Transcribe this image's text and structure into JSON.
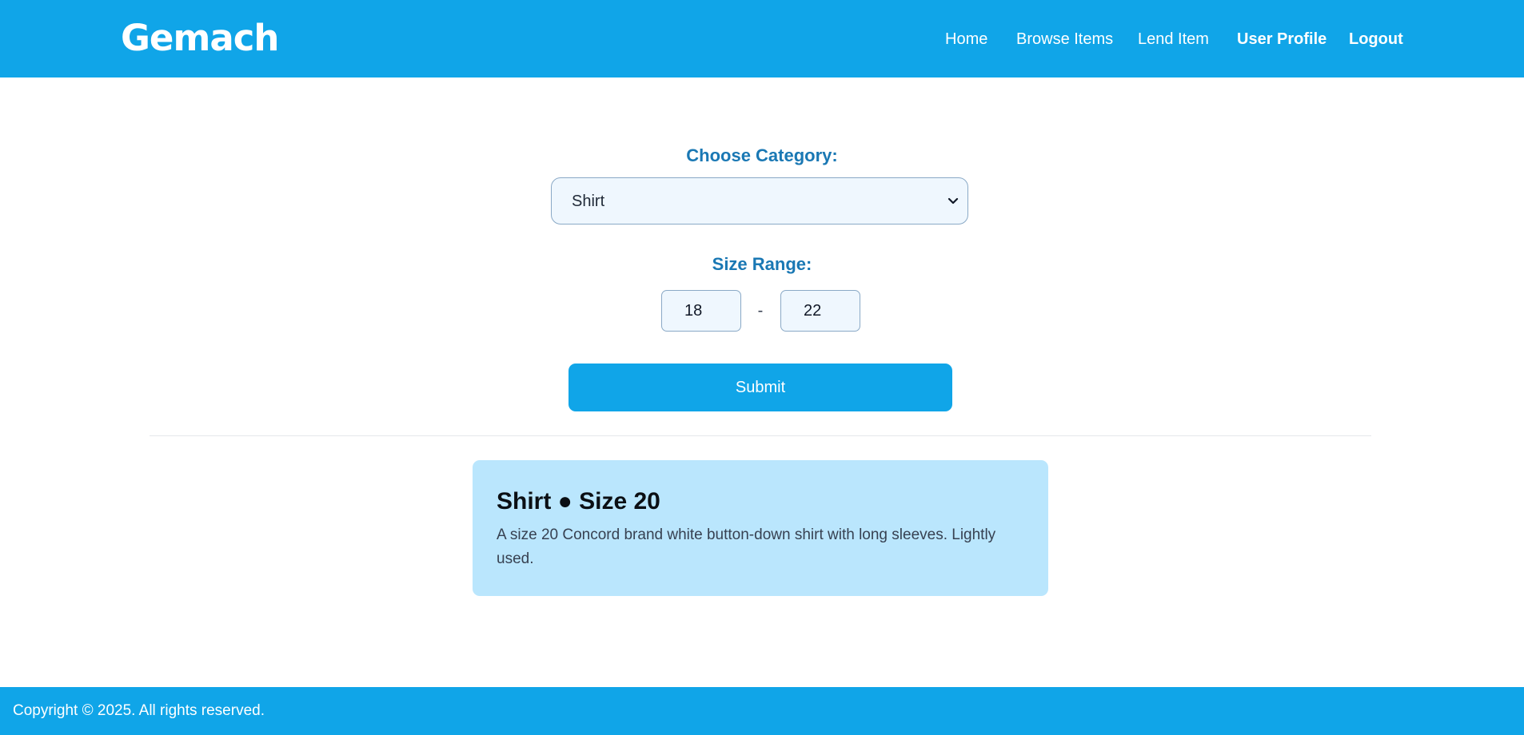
{
  "header": {
    "logo": "Gemach",
    "nav": {
      "home": "Home",
      "browse": "Browse Items",
      "lend": "Lend Item",
      "profile": "User Profile",
      "logout": "Logout"
    }
  },
  "form": {
    "category_label": "Choose Category:",
    "category_value": "Shirt",
    "size_label": "Size Range:",
    "size_min": "18",
    "size_separator": "-",
    "size_max": "22",
    "submit_label": "Submit"
  },
  "result": {
    "title": "Shirt ● Size 20",
    "description": "A size 20 Concord brand white button-down shirt with long sleeves. Lightly used."
  },
  "footer": {
    "copyright": "Copyright © 2025. All rights reserved."
  },
  "colors": {
    "brand": "#10a5e8",
    "label": "#1a78b4",
    "card": "#bae6fd",
    "input_bg": "#eff7fe"
  },
  "icons": {
    "select": "chevron-down-icon"
  }
}
